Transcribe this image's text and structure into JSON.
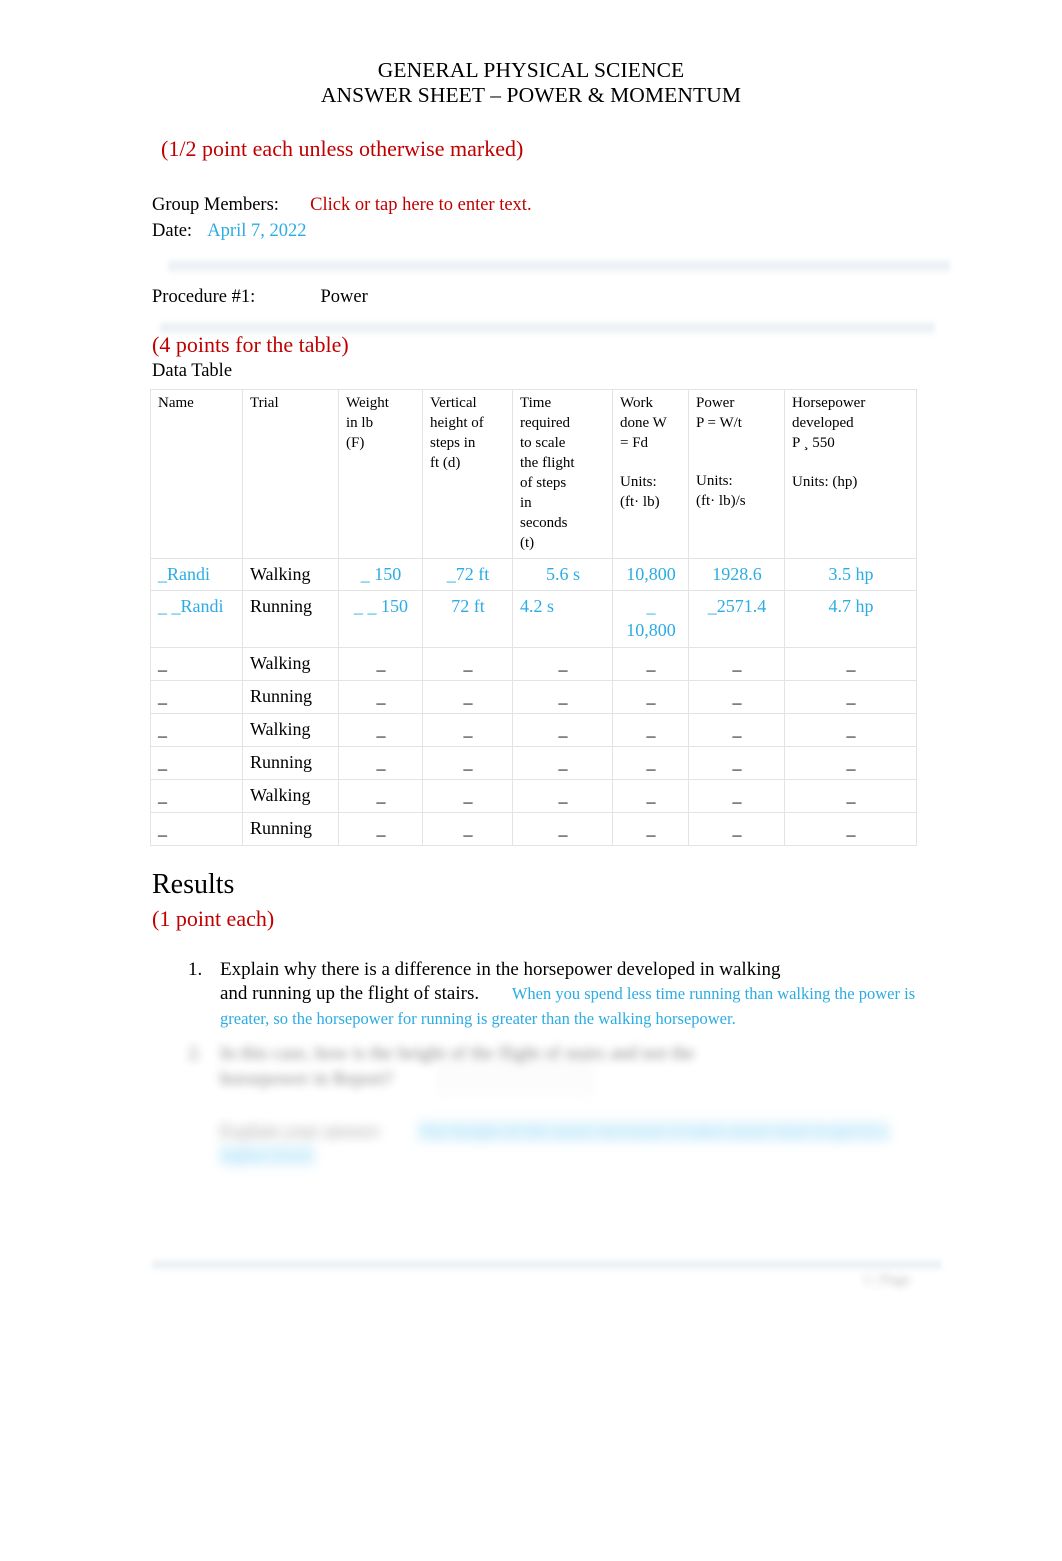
{
  "document": {
    "title_line1": "GENERAL PHYSICAL SCIENCE",
    "title_line2": "ANSWER SHEET – POWER & MOMENTUM",
    "points_note_top": "(1/2 point each unless otherwise marked)",
    "group_members_label": "Group Members:",
    "group_members_value": "Click or tap here to enter text.",
    "date_label": "Date:",
    "date_value": "April 7, 2022",
    "procedure_label": "Procedure #1:",
    "procedure_value": "Power",
    "table_points_note": "(4 points for the table)",
    "data_table_label": "Data Table"
  },
  "colors": {
    "heading_red": "#C00000",
    "answer_cyan": "#2BACE3",
    "highlight_cyan": "#BFE9FB",
    "table_border": "#E3E3E3",
    "text_black": "#000000"
  },
  "chart_data": {
    "type": "table",
    "title": "Data Table",
    "columns": [
      "Name",
      "Trial",
      "Weight in lb (F)",
      "Vertical height of steps in ft (d)",
      "Time required to scale the flight of steps in seconds (t)",
      "Work done W = Fd",
      "Power P = W/t",
      "Horsepower developed P ¸ 550"
    ],
    "column_units": [
      "",
      "",
      "",
      "",
      "",
      "(ft lb)",
      "(ft lb)/s",
      "(hp)"
    ],
    "rows": [
      {
        "name": "_Randi",
        "trial": "Walking",
        "weight": "_ 150",
        "height": "_72 ft",
        "time": "5.6 s",
        "work": "10,800",
        "power": "1928.6",
        "horsepower": "3.5 hp"
      },
      {
        "name": "_ _Randi",
        "trial": "Running",
        "weight": "_ _ 150",
        "height": "72 ft",
        "time": "4.2 s",
        "work": "_ 10,800",
        "power": "_2571.4",
        "horsepower": "4.7 hp"
      },
      {
        "name": "_",
        "trial": "Walking",
        "weight": "_",
        "height": "_",
        "time": "_",
        "work": "_",
        "power": "_",
        "horsepower": "_"
      },
      {
        "name": "_",
        "trial": "Running",
        "weight": "_",
        "height": "_",
        "time": "_",
        "work": "_",
        "power": "_",
        "horsepower": "_"
      },
      {
        "name": "_",
        "trial": "Walking",
        "weight": "_",
        "height": "_",
        "time": "_",
        "work": "_",
        "power": "_",
        "horsepower": "_"
      },
      {
        "name": "_",
        "trial": "Running",
        "weight": "_",
        "height": "_",
        "time": "_",
        "work": "_",
        "power": "_",
        "horsepower": "_"
      },
      {
        "name": "_",
        "trial": "Walking",
        "weight": "_",
        "height": "_",
        "time": "_",
        "work": "_",
        "power": "_",
        "horsepower": "_"
      },
      {
        "name": "_",
        "trial": "Running",
        "weight": "_",
        "height": "_",
        "time": "_",
        "work": "_",
        "power": "_",
        "horsepower": "_"
      }
    ]
  },
  "table_headers": {
    "name": "Name",
    "trial": "Trial",
    "weight_l1": "Weight",
    "weight_l2": "in lb",
    "weight_l3": "(F)",
    "height_l1": "Vertical",
    "height_l2": "height of",
    "height_l3": "steps in",
    "height_l4": "ft (d)",
    "time_l1": "Time",
    "time_l2": "required",
    "time_l3": "to scale",
    "time_l4": "the flight",
    "time_l5": "of steps",
    "time_l6": "in",
    "time_l7": "seconds",
    "time_l8": "(t)",
    "work_l1": "Work",
    "work_l2": "done W",
    "work_l3": "= Fd",
    "work_units_l1": "Units:",
    "work_units_l2": "(ft· lb)",
    "power_l1": "Power",
    "power_l2": "P = W/t",
    "power_units_l1": "Units:",
    "power_units_l2": "(ft· lb)/s",
    "hp_l1": "Horsepower",
    "hp_l2": "developed",
    "hp_l3": "P ¸  550",
    "hp_units": "Units:   (hp)"
  },
  "results": {
    "heading": "Results",
    "points_note": "(1 point each)",
    "questions": [
      {
        "number": "1.",
        "prompt_line1": "Explain why there is a difference in the horsepower developed in walking",
        "prompt_line2": "and running up the flight of stairs.",
        "answer": "When you spend less time running than walking the power is greater, so the horsepower for running is greater than the walking horsepower."
      },
      {
        "number": "2.",
        "prompt_line1": "In this case, how is the height of the flight of stairs and not the",
        "prompt_line2": "horsepower in Report?",
        "answer_label": "Explain your answer:",
        "answer": "The height of the stairs increases it takes more time to get to a higher level."
      }
    ]
  },
  "footer": {
    "page_marker": "1 | Page"
  }
}
